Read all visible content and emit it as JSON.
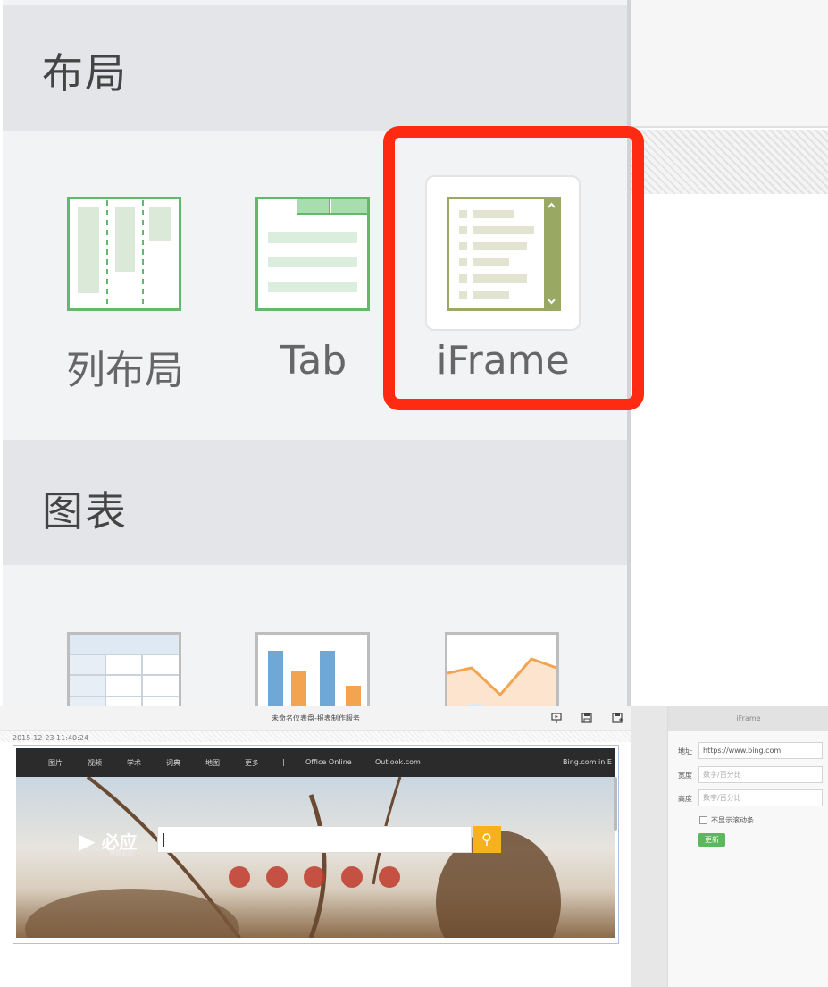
{
  "layout_section": {
    "title": "布局",
    "tools": [
      {
        "label": "列布局",
        "icon": "column-layout-icon"
      },
      {
        "label": "Tab",
        "icon": "tab-layout-icon"
      },
      {
        "label": "iFrame",
        "icon": "iframe-icon"
      }
    ]
  },
  "chart_section": {
    "title": "图表",
    "tools": [
      {
        "icon": "table-chart-icon"
      },
      {
        "icon": "bar-chart-icon"
      },
      {
        "icon": "area-chart-icon"
      }
    ]
  },
  "colors": {
    "highlight": "#ff2a12",
    "layout_green": "#63b96b",
    "iframe_olive": "#99a862",
    "bar_blue": "#6fa8d6",
    "bar_orange": "#f2a451"
  },
  "editor": {
    "title": "未命名仪表盘-报表制作服务",
    "timestamp": "2015-12-23 11:40:24",
    "toolbar_icons": [
      "preview-icon",
      "save-icon",
      "save-as-icon",
      "add-icon"
    ],
    "bing": {
      "nav": [
        "图片",
        "视频",
        "学术",
        "词典",
        "地图",
        "更多",
        "|",
        "Office Online",
        "Outlook.com"
      ],
      "nav_right": "Bing.com in E",
      "logo": "必应",
      "logo_sub": "微软必应",
      "search_icon": "search-icon"
    },
    "props": {
      "title": "iFrame",
      "address_label": "地址",
      "address_value": "https://www.bing.com",
      "width_label": "宽度",
      "width_placeholder": "数字/百分比",
      "height_label": "高度",
      "height_placeholder": "数字/百分比",
      "no_scroll_label": "不显示滚动条",
      "update_button": "更新"
    }
  }
}
